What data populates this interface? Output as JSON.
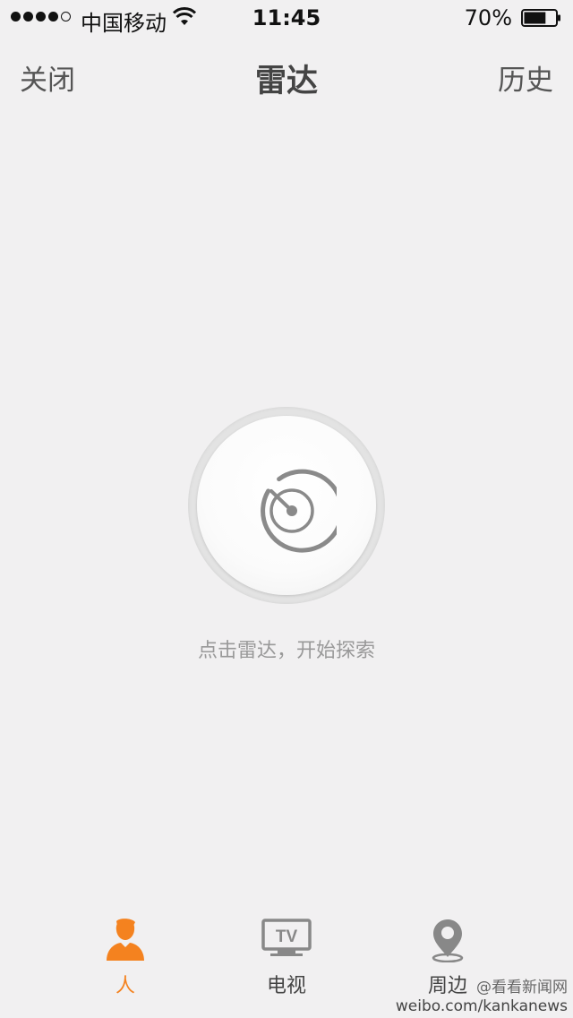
{
  "status_bar": {
    "carrier": "中国移动",
    "time": "11:45",
    "battery_percent": "70%",
    "signal_bars_filled": 4,
    "signal_bars_total": 5,
    "battery_level": 0.7
  },
  "nav": {
    "left_label": "关闭",
    "title": "雷达",
    "right_label": "历史"
  },
  "radar": {
    "hint": "点击雷达，开始探索"
  },
  "tabs": [
    {
      "label": "人",
      "icon": "person-icon",
      "active": true
    },
    {
      "label": "电视",
      "icon": "tv-icon",
      "active": false,
      "icon_text": "TV"
    },
    {
      "label": "周边",
      "icon": "location-pin-icon",
      "active": false
    }
  ],
  "watermark": {
    "line1": "@看看新闻网",
    "line2": "weibo.com/kankanews"
  },
  "colors": {
    "background": "#f1f0f1",
    "accent": "#f4821f",
    "icon_gray": "#888888"
  }
}
